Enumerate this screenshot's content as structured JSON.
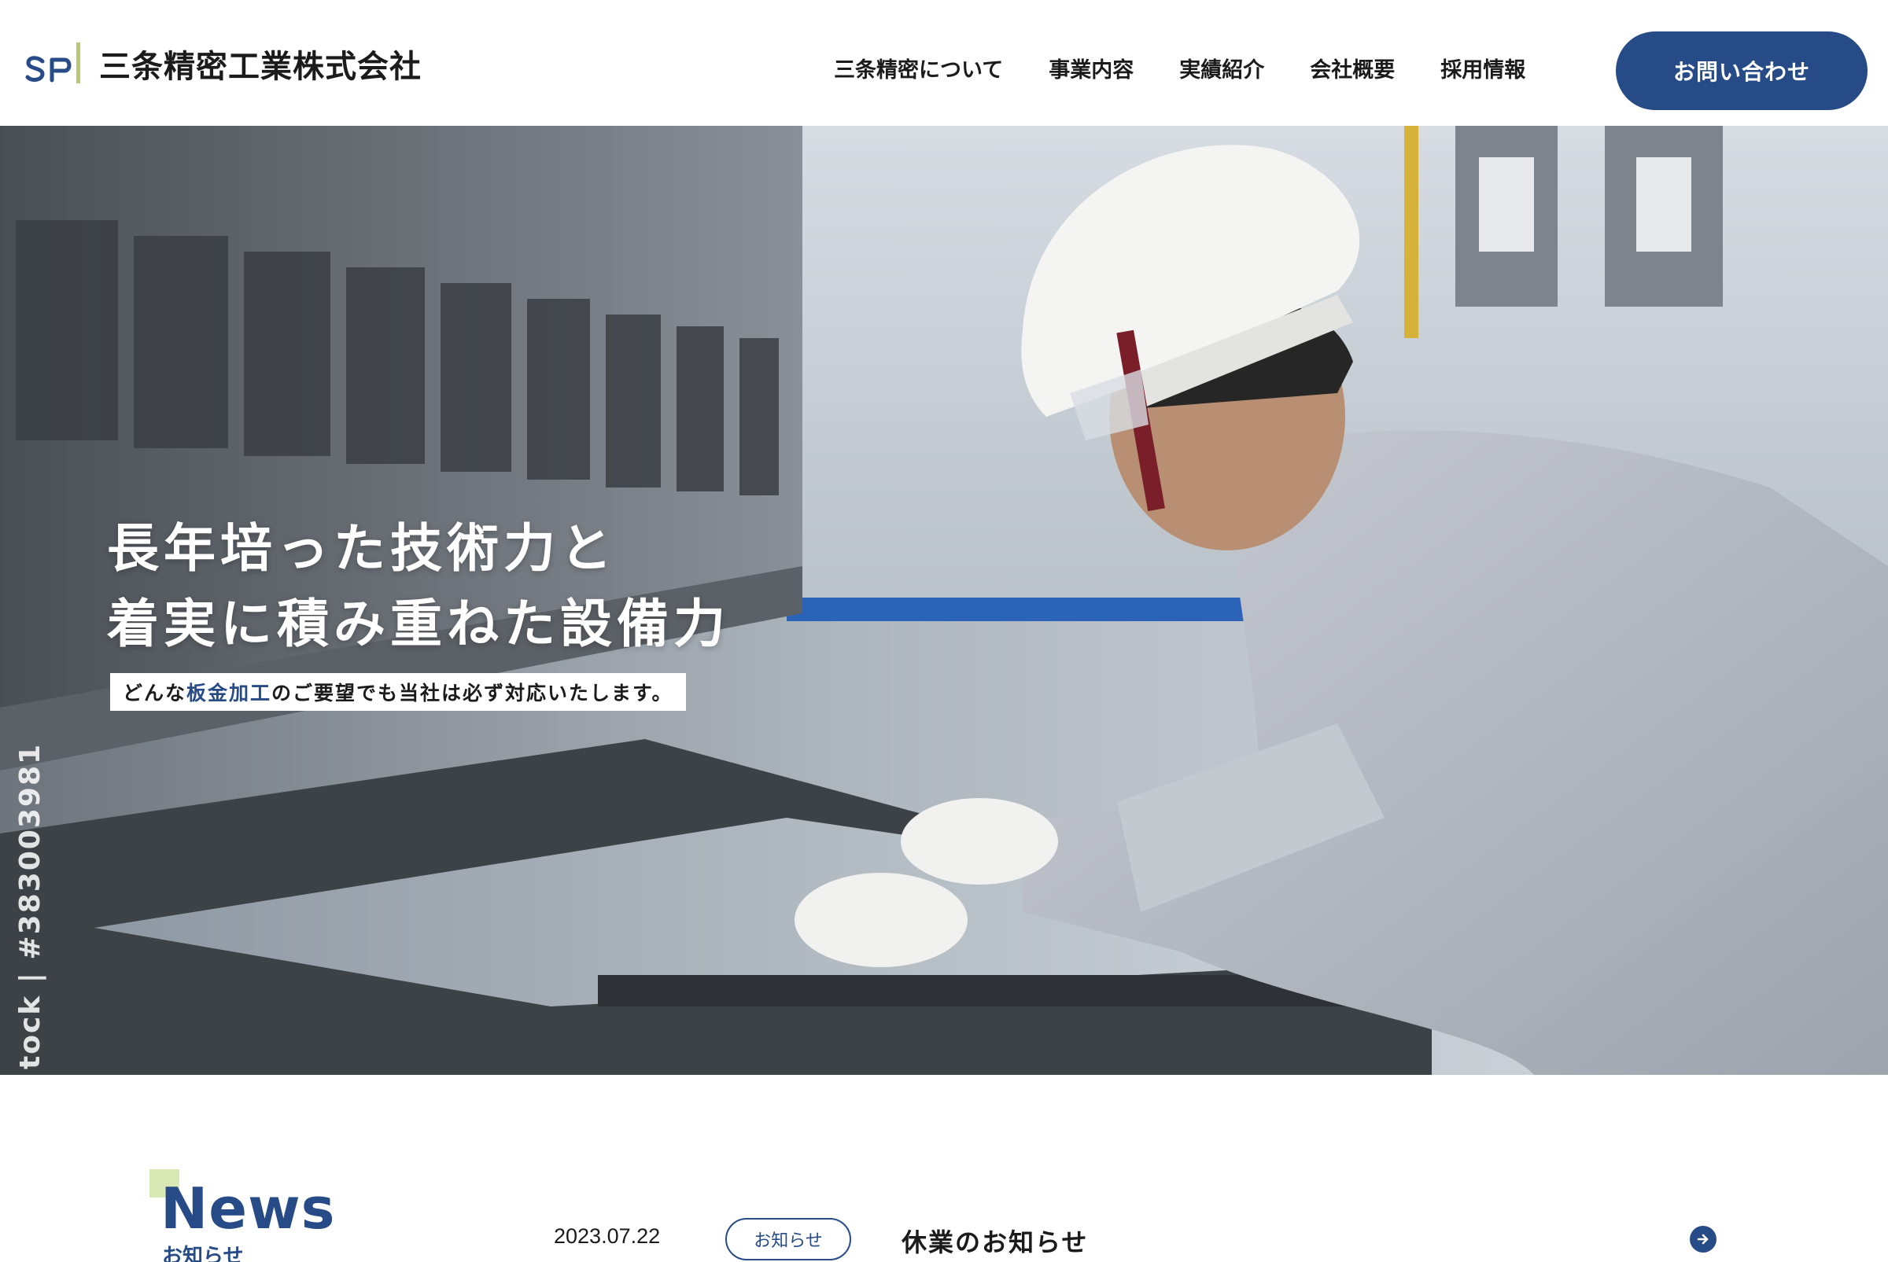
{
  "header": {
    "logo_mark": "SPI",
    "company_name": "三条精密工業株式会社",
    "nav": [
      {
        "label": "三条精密について"
      },
      {
        "label": "事業内容"
      },
      {
        "label": "実績紹介"
      },
      {
        "label": "会社概要"
      },
      {
        "label": "採用情報"
      }
    ],
    "contact_label": "お問い合わせ"
  },
  "hero": {
    "headline_line1": "長年培った技術力と",
    "headline_line2": "着実に積み重ねた設備力",
    "sub_prefix": "どんな",
    "sub_accent": "板金加工",
    "sub_suffix": "のご要望でも当社は必ず対応いたします。",
    "stock_id": "tock | #383003981"
  },
  "news": {
    "title": "News",
    "subtitle": "お知らせ",
    "items": [
      {
        "date": "2023.07.22",
        "category": "お知らせ",
        "title": "休業のお知らせ"
      }
    ]
  },
  "colors": {
    "brand_navy": "#264b86",
    "accent_green": "#d8e7b3"
  }
}
